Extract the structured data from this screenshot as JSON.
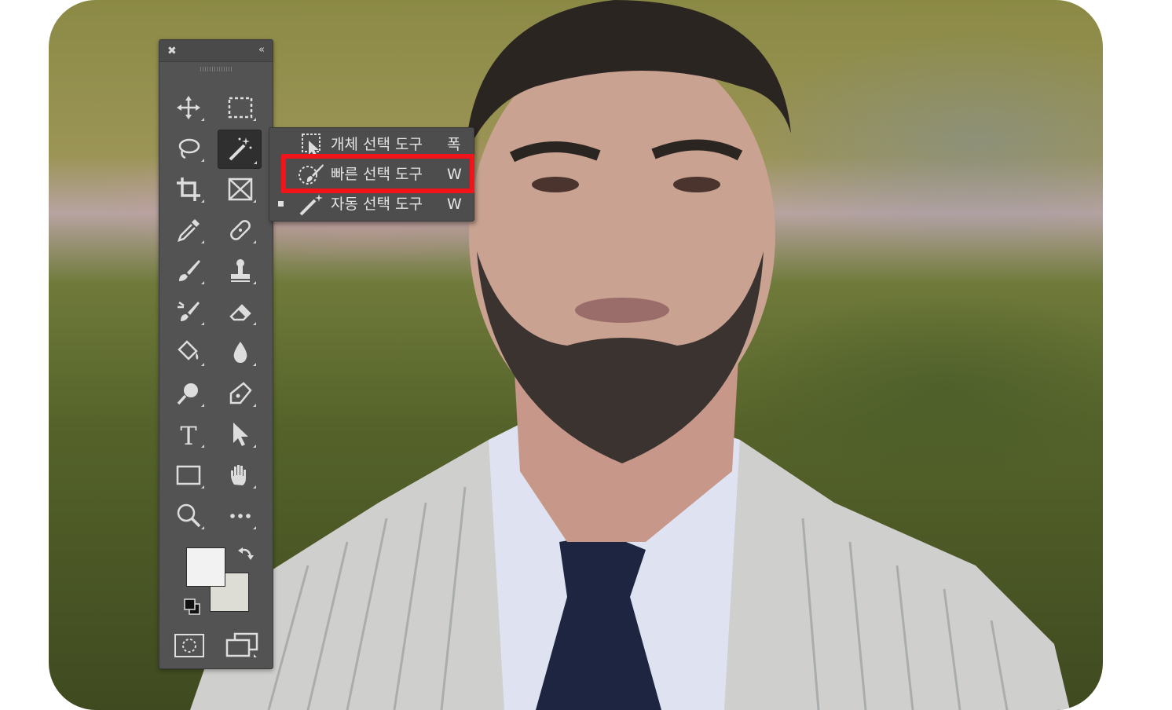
{
  "panel": {
    "close_glyph": "✖",
    "collapse_glyph": "«",
    "tools_left": [
      {
        "name": "move-tool",
        "icon": "move-icon"
      },
      {
        "name": "lasso-tool",
        "icon": "lasso-icon"
      },
      {
        "name": "crop-tool",
        "icon": "crop-icon"
      },
      {
        "name": "eyedropper-tool",
        "icon": "eyedropper-icon"
      },
      {
        "name": "brush-tool",
        "icon": "brush-icon"
      },
      {
        "name": "history-brush-tool",
        "icon": "history-brush-icon"
      },
      {
        "name": "paint-bucket-tool",
        "icon": "paint-bucket-icon"
      },
      {
        "name": "dodge-tool",
        "icon": "dodge-icon"
      },
      {
        "name": "type-tool",
        "icon": "type-icon"
      },
      {
        "name": "rectangle-tool",
        "icon": "rectangle-icon"
      },
      {
        "name": "zoom-tool",
        "icon": "zoom-icon"
      }
    ],
    "tools_right": [
      {
        "name": "marquee-tool",
        "icon": "marquee-icon"
      },
      {
        "name": "magic-wand-tool",
        "icon": "magic-wand-icon"
      },
      {
        "name": "frame-tool",
        "icon": "frame-icon"
      },
      {
        "name": "healing-brush-tool",
        "icon": "bandage-icon"
      },
      {
        "name": "clone-stamp-tool",
        "icon": "stamp-icon"
      },
      {
        "name": "eraser-tool",
        "icon": "eraser-icon"
      },
      {
        "name": "blur-tool",
        "icon": "drop-icon"
      },
      {
        "name": "pen-tool",
        "icon": "pen-icon"
      },
      {
        "name": "path-selection-tool",
        "icon": "arrow-icon"
      },
      {
        "name": "hand-tool",
        "icon": "hand-icon"
      },
      {
        "name": "more-tools",
        "icon": "more-icon"
      }
    ],
    "type_glyph": "T",
    "foreground_color": "#f2f2f2",
    "background_color": "#ddddd5"
  },
  "flyout": {
    "items": [
      {
        "label": "개체 선택 도구",
        "shortcut": "폭",
        "icon": "object-selection-icon",
        "selected": false
      },
      {
        "label": "빠른 선택 도구",
        "shortcut": "W",
        "icon": "quick-selection-icon",
        "selected": false,
        "highlighted": true
      },
      {
        "label": "자동 선택 도구",
        "shortcut": "W",
        "icon": "magic-wand-icon",
        "selected": true
      }
    ],
    "highlight_color": "#f1141b"
  }
}
